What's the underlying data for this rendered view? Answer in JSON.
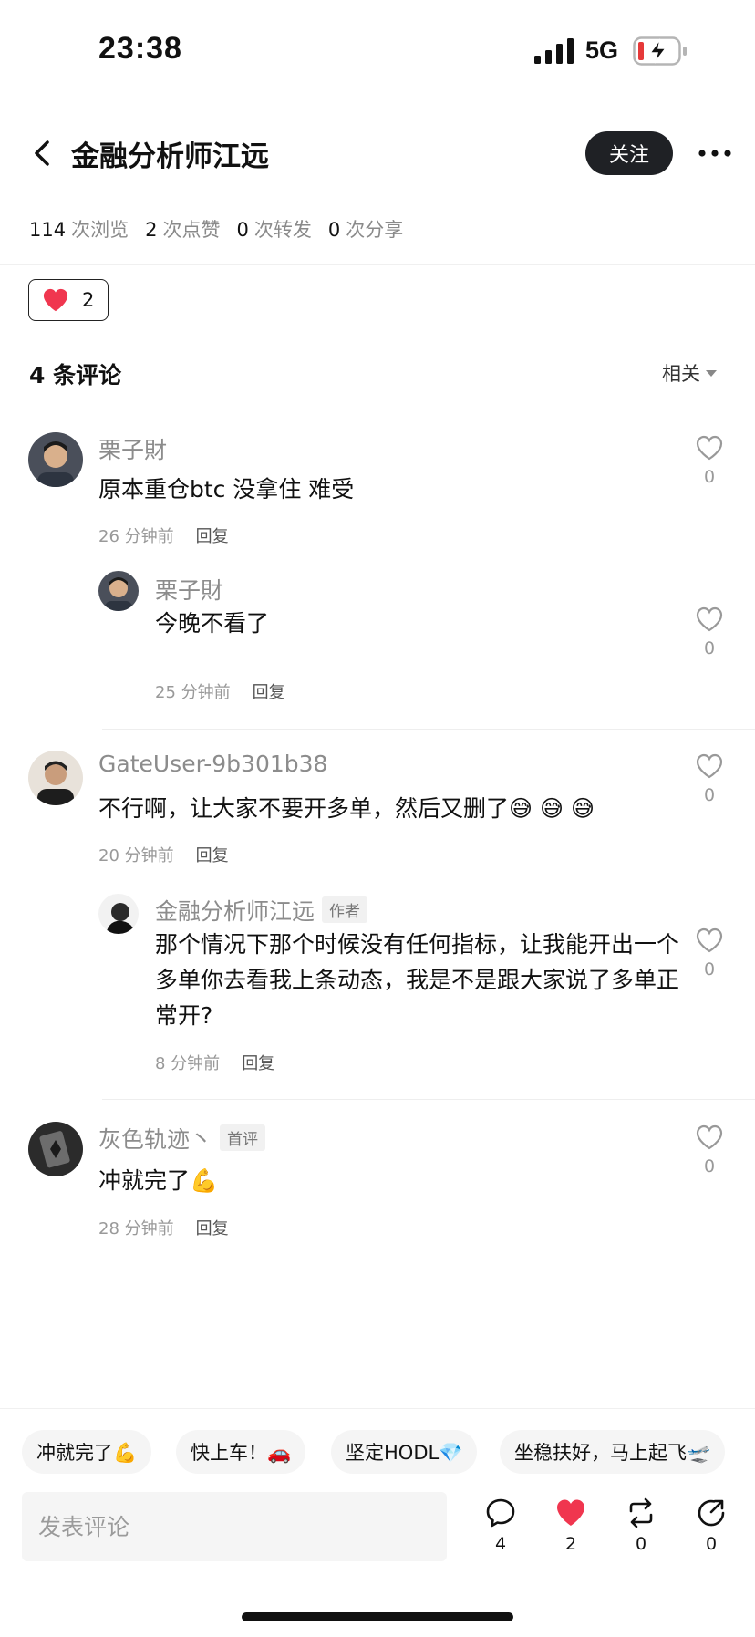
{
  "status": {
    "time": "23:38",
    "network": "5G"
  },
  "header": {
    "title": "金融分析师江远",
    "follow_label": "关注"
  },
  "stats": [
    {
      "value": "114",
      "label": "次浏览"
    },
    {
      "value": "2",
      "label": "次点赞"
    },
    {
      "value": "0",
      "label": "次转发"
    },
    {
      "value": "0",
      "label": "次分享"
    }
  ],
  "post_likes": "2",
  "comments_header": {
    "title": "4 条评论",
    "sort_label": "相关"
  },
  "comments": [
    {
      "name": "栗子財",
      "text": "原本重仓btc 没拿住 难受",
      "time": "26 分钟前",
      "reply_label": "回复",
      "likes": "0",
      "replies": [
        {
          "name": "栗子財",
          "text": "今晚不看了",
          "time": "25 分钟前",
          "reply_label": "回复",
          "likes": "0"
        }
      ]
    },
    {
      "name": "GateUser-9b301b38",
      "text": "不行啊，让大家不要开多单，然后又删了😅 😅 😅",
      "time": "20 分钟前",
      "reply_label": "回复",
      "likes": "0",
      "replies": [
        {
          "name": "金融分析师江远",
          "tag": "作者",
          "text": "那个情况下那个时候没有任何指标，让我能开出一个多单你去看我上条动态，我是不是跟大家说了多单正常开?",
          "time": "8 分钟前",
          "reply_label": "回复",
          "likes": "0"
        }
      ]
    },
    {
      "name": "灰色轨迹丶",
      "tag": "首评",
      "text": "冲就完了💪",
      "time": "28 分钟前",
      "reply_label": "回复",
      "likes": "0",
      "replies": []
    }
  ],
  "quick_replies": [
    "冲就完了💪",
    "快上车！🚗",
    "坚定HODL💎",
    "坐稳扶好，马上起飞🛫"
  ],
  "comment_input": {
    "placeholder": "发表评论"
  },
  "actions": {
    "comments": "4",
    "likes": "2",
    "reposts": "0",
    "shares": "0"
  },
  "colors": {
    "like_red": "#f0364f",
    "follow_bg": "#1f2125"
  }
}
